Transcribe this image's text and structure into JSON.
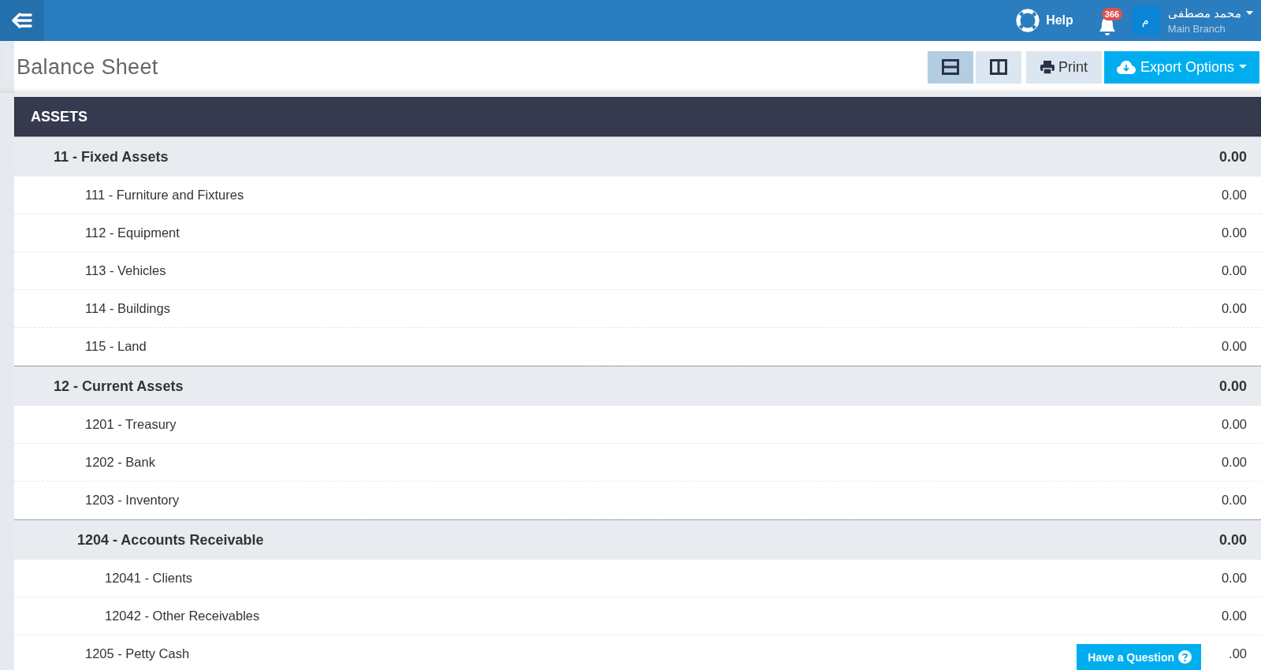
{
  "topbar": {
    "help": "Help",
    "notifications": "366",
    "avatar": "م",
    "user": "محمد مصطفى",
    "branch": "Main Branch"
  },
  "header": {
    "title": "Balance Sheet",
    "views": [
      {
        "kind": "rows",
        "selected": true
      },
      {
        "kind": "columns",
        "selected": false
      }
    ],
    "print": "Print",
    "export": "Export Options"
  },
  "section": "ASSETS",
  "rows": [
    {
      "kind": "group",
      "label": "11 - Fixed Assets",
      "amount": "0.00",
      "children": [
        {
          "kind": "account",
          "label": "111 - Furniture and Fixtures",
          "amount": "0.00"
        },
        {
          "kind": "account",
          "label": "112 - Equipment",
          "amount": "0.00"
        },
        {
          "kind": "account",
          "label": "113 - Vehicles",
          "amount": "0.00"
        },
        {
          "kind": "account",
          "label": "114 - Buildings",
          "amount": "0.00"
        },
        {
          "kind": "account",
          "label": "115 - Land",
          "amount": "0.00"
        }
      ]
    },
    {
      "kind": "group",
      "label": "12 - Current Assets",
      "amount": "0.00",
      "children": [
        {
          "kind": "account",
          "label": "1201 - Treasury",
          "amount": "0.00"
        },
        {
          "kind": "account",
          "label": "1202 - Bank",
          "amount": "0.00"
        },
        {
          "kind": "account",
          "label": "1203 - Inventory",
          "amount": "0.00"
        },
        {
          "kind": "group",
          "label": "1204 - Accounts Receivable",
          "amount": "0.00",
          "children": [
            {
              "kind": "account",
              "label": "12041 - Clients",
              "amount": "0.00"
            },
            {
              "kind": "account",
              "label": "12042 - Other Receivables",
              "amount": "0.00"
            }
          ]
        },
        {
          "kind": "account",
          "label": "1205 - Petty Cash",
          "amount": ".00"
        }
      ]
    }
  ],
  "help_button": "Have a Question"
}
